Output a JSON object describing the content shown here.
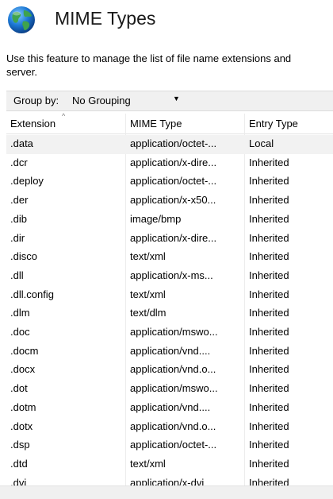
{
  "header": {
    "title": "MIME Types",
    "description": "Use this feature to manage the list of file name extensions and\nserver."
  },
  "toolbar": {
    "group_by_label": "Group by:",
    "group_by_value": "No Grouping"
  },
  "columns": [
    "Extension",
    "MIME Type",
    "Entry Type"
  ],
  "rows": [
    [
      ".data",
      "application/octet-...",
      "Local"
    ],
    [
      ".dcr",
      "application/x-dire...",
      "Inherited"
    ],
    [
      ".deploy",
      "application/octet-...",
      "Inherited"
    ],
    [
      ".der",
      "application/x-x50...",
      "Inherited"
    ],
    [
      ".dib",
      "image/bmp",
      "Inherited"
    ],
    [
      ".dir",
      "application/x-dire...",
      "Inherited"
    ],
    [
      ".disco",
      "text/xml",
      "Inherited"
    ],
    [
      ".dll",
      "application/x-ms...",
      "Inherited"
    ],
    [
      ".dll.config",
      "text/xml",
      "Inherited"
    ],
    [
      ".dlm",
      "text/dlm",
      "Inherited"
    ],
    [
      ".doc",
      "application/mswo...",
      "Inherited"
    ],
    [
      ".docm",
      "application/vnd....",
      "Inherited"
    ],
    [
      ".docx",
      "application/vnd.o...",
      "Inherited"
    ],
    [
      ".dot",
      "application/mswo...",
      "Inherited"
    ],
    [
      ".dotm",
      "application/vnd....",
      "Inherited"
    ],
    [
      ".dotx",
      "application/vnd.o...",
      "Inherited"
    ],
    [
      ".dsp",
      "application/octet-...",
      "Inherited"
    ],
    [
      ".dtd",
      "text/xml",
      "Inherited"
    ],
    [
      ".dvi",
      "application/x-dvi",
      "Inherited"
    ]
  ],
  "selected_row": 0,
  "colors": {
    "selection": "#f2f2f2",
    "toolbar": "#f0f0f0",
    "grid_line": "#ececec"
  },
  "icons": {
    "header": "globe-icon",
    "dropdown": "chevron-down-icon",
    "sort": "sort-ascending-icon"
  }
}
